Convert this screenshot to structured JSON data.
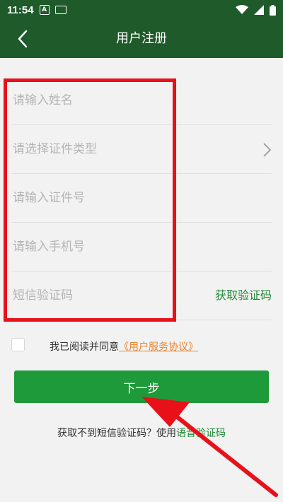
{
  "status_bar": {
    "time": "11:54",
    "icons": [
      "a-notification-icon",
      "keyboard-icon",
      "wifi-icon",
      "cellular-icon",
      "battery-icon"
    ]
  },
  "nav": {
    "title": "用户注册",
    "back_icon": "chevron-left-icon"
  },
  "form": {
    "name_placeholder": "请输入姓名",
    "id_type_placeholder": "请选择证件类型",
    "id_number_placeholder": "请输入证件号",
    "phone_placeholder": "请输入手机号",
    "sms_code_placeholder": "短信验证码",
    "get_code_label": "获取验证码"
  },
  "agreement": {
    "checked": false,
    "prefix": "我已阅读并同意",
    "link_label": "《用户服务协议》"
  },
  "next_button_label": "下一步",
  "footer": {
    "text": "获取不到短信验证码？使用",
    "voice_link": "语音验证码"
  },
  "colors": {
    "header_bg": "#1f5a2a",
    "primary_button": "#1f9a3a",
    "link_green": "#1f8b34",
    "link_orange": "#e8852e",
    "annotation_red": "#e8111a"
  }
}
